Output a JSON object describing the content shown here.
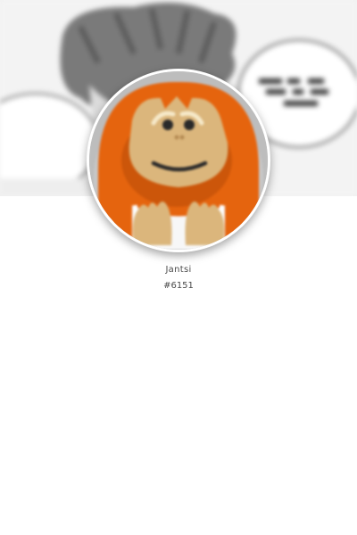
{
  "profile": {
    "username": "Jantsi",
    "discriminator": "#6151",
    "avatar_icon": "orangutan-icon"
  },
  "colors": {
    "orangutan_fur": "#e5640e",
    "orangutan_face": "#dbb67c",
    "banner_background": "#f2f2f2"
  }
}
